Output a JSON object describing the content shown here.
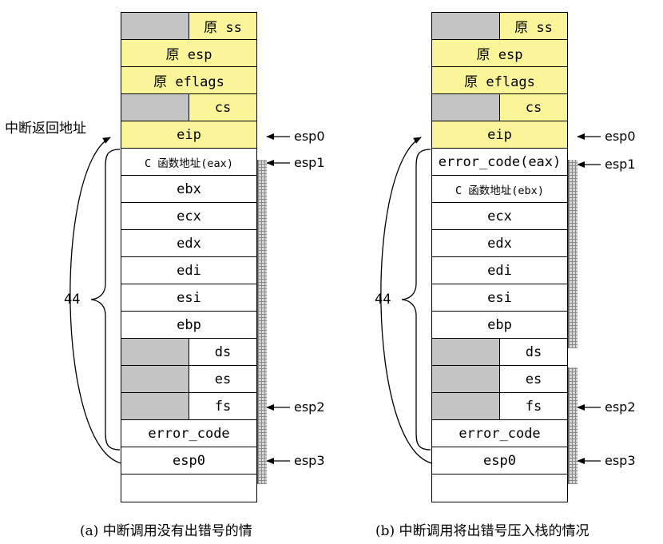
{
  "diagram_a": {
    "rows": [
      {
        "label": "原 ss",
        "style": "split-yellow"
      },
      {
        "label": "原 esp",
        "style": "yellow"
      },
      {
        "label": "原 eflags",
        "style": "yellow"
      },
      {
        "label": "cs",
        "style": "split-yellow"
      },
      {
        "label": "eip",
        "style": "yellow"
      },
      {
        "label": "C 函数地址(eax)",
        "style": "small"
      },
      {
        "label": "ebx",
        "style": "plain"
      },
      {
        "label": "ecx",
        "style": "plain"
      },
      {
        "label": "edx",
        "style": "plain"
      },
      {
        "label": "edi",
        "style": "plain"
      },
      {
        "label": "esi",
        "style": "plain"
      },
      {
        "label": "ebp",
        "style": "plain"
      },
      {
        "label": "ds",
        "style": "split"
      },
      {
        "label": "es",
        "style": "split"
      },
      {
        "label": "fs",
        "style": "split"
      },
      {
        "label": "error_code",
        "style": "plain"
      },
      {
        "label": "esp0",
        "style": "plain"
      },
      {
        "label": "",
        "style": "plain"
      }
    ],
    "return_label": "中断返回地址",
    "brace_label": "44",
    "pointers": {
      "esp0": "esp0",
      "esp1": "esp1",
      "esp2": "esp2",
      "esp3": "esp3"
    },
    "caption": "(a) 中断调用没有出错号的情"
  },
  "diagram_b": {
    "rows": [
      {
        "label": "原 ss",
        "style": "split-yellow"
      },
      {
        "label": "原 esp",
        "style": "yellow"
      },
      {
        "label": "原 eflags",
        "style": "yellow"
      },
      {
        "label": "cs",
        "style": "split-yellow"
      },
      {
        "label": "eip",
        "style": "yellow"
      },
      {
        "label": "error_code(eax)",
        "style": "plain"
      },
      {
        "label": "C 函数地址(ebx)",
        "style": "small"
      },
      {
        "label": "ecx",
        "style": "plain"
      },
      {
        "label": "edx",
        "style": "plain"
      },
      {
        "label": "edi",
        "style": "plain"
      },
      {
        "label": "esi",
        "style": "plain"
      },
      {
        "label": "ebp",
        "style": "plain"
      },
      {
        "label": "ds",
        "style": "split"
      },
      {
        "label": "es",
        "style": "split"
      },
      {
        "label": "fs",
        "style": "split"
      },
      {
        "label": "error_code",
        "style": "plain"
      },
      {
        "label": "esp0",
        "style": "plain"
      },
      {
        "label": "",
        "style": "plain"
      }
    ],
    "brace_label": "44",
    "pointers": {
      "esp0": "esp0",
      "esp1": "esp1",
      "esp2": "esp2",
      "esp3": "esp3"
    },
    "caption": "(b) 中断调用将出错号压入栈的情况"
  },
  "colors": {
    "highlight": "#fbf59a",
    "reserved": "#c4c4c4"
  }
}
